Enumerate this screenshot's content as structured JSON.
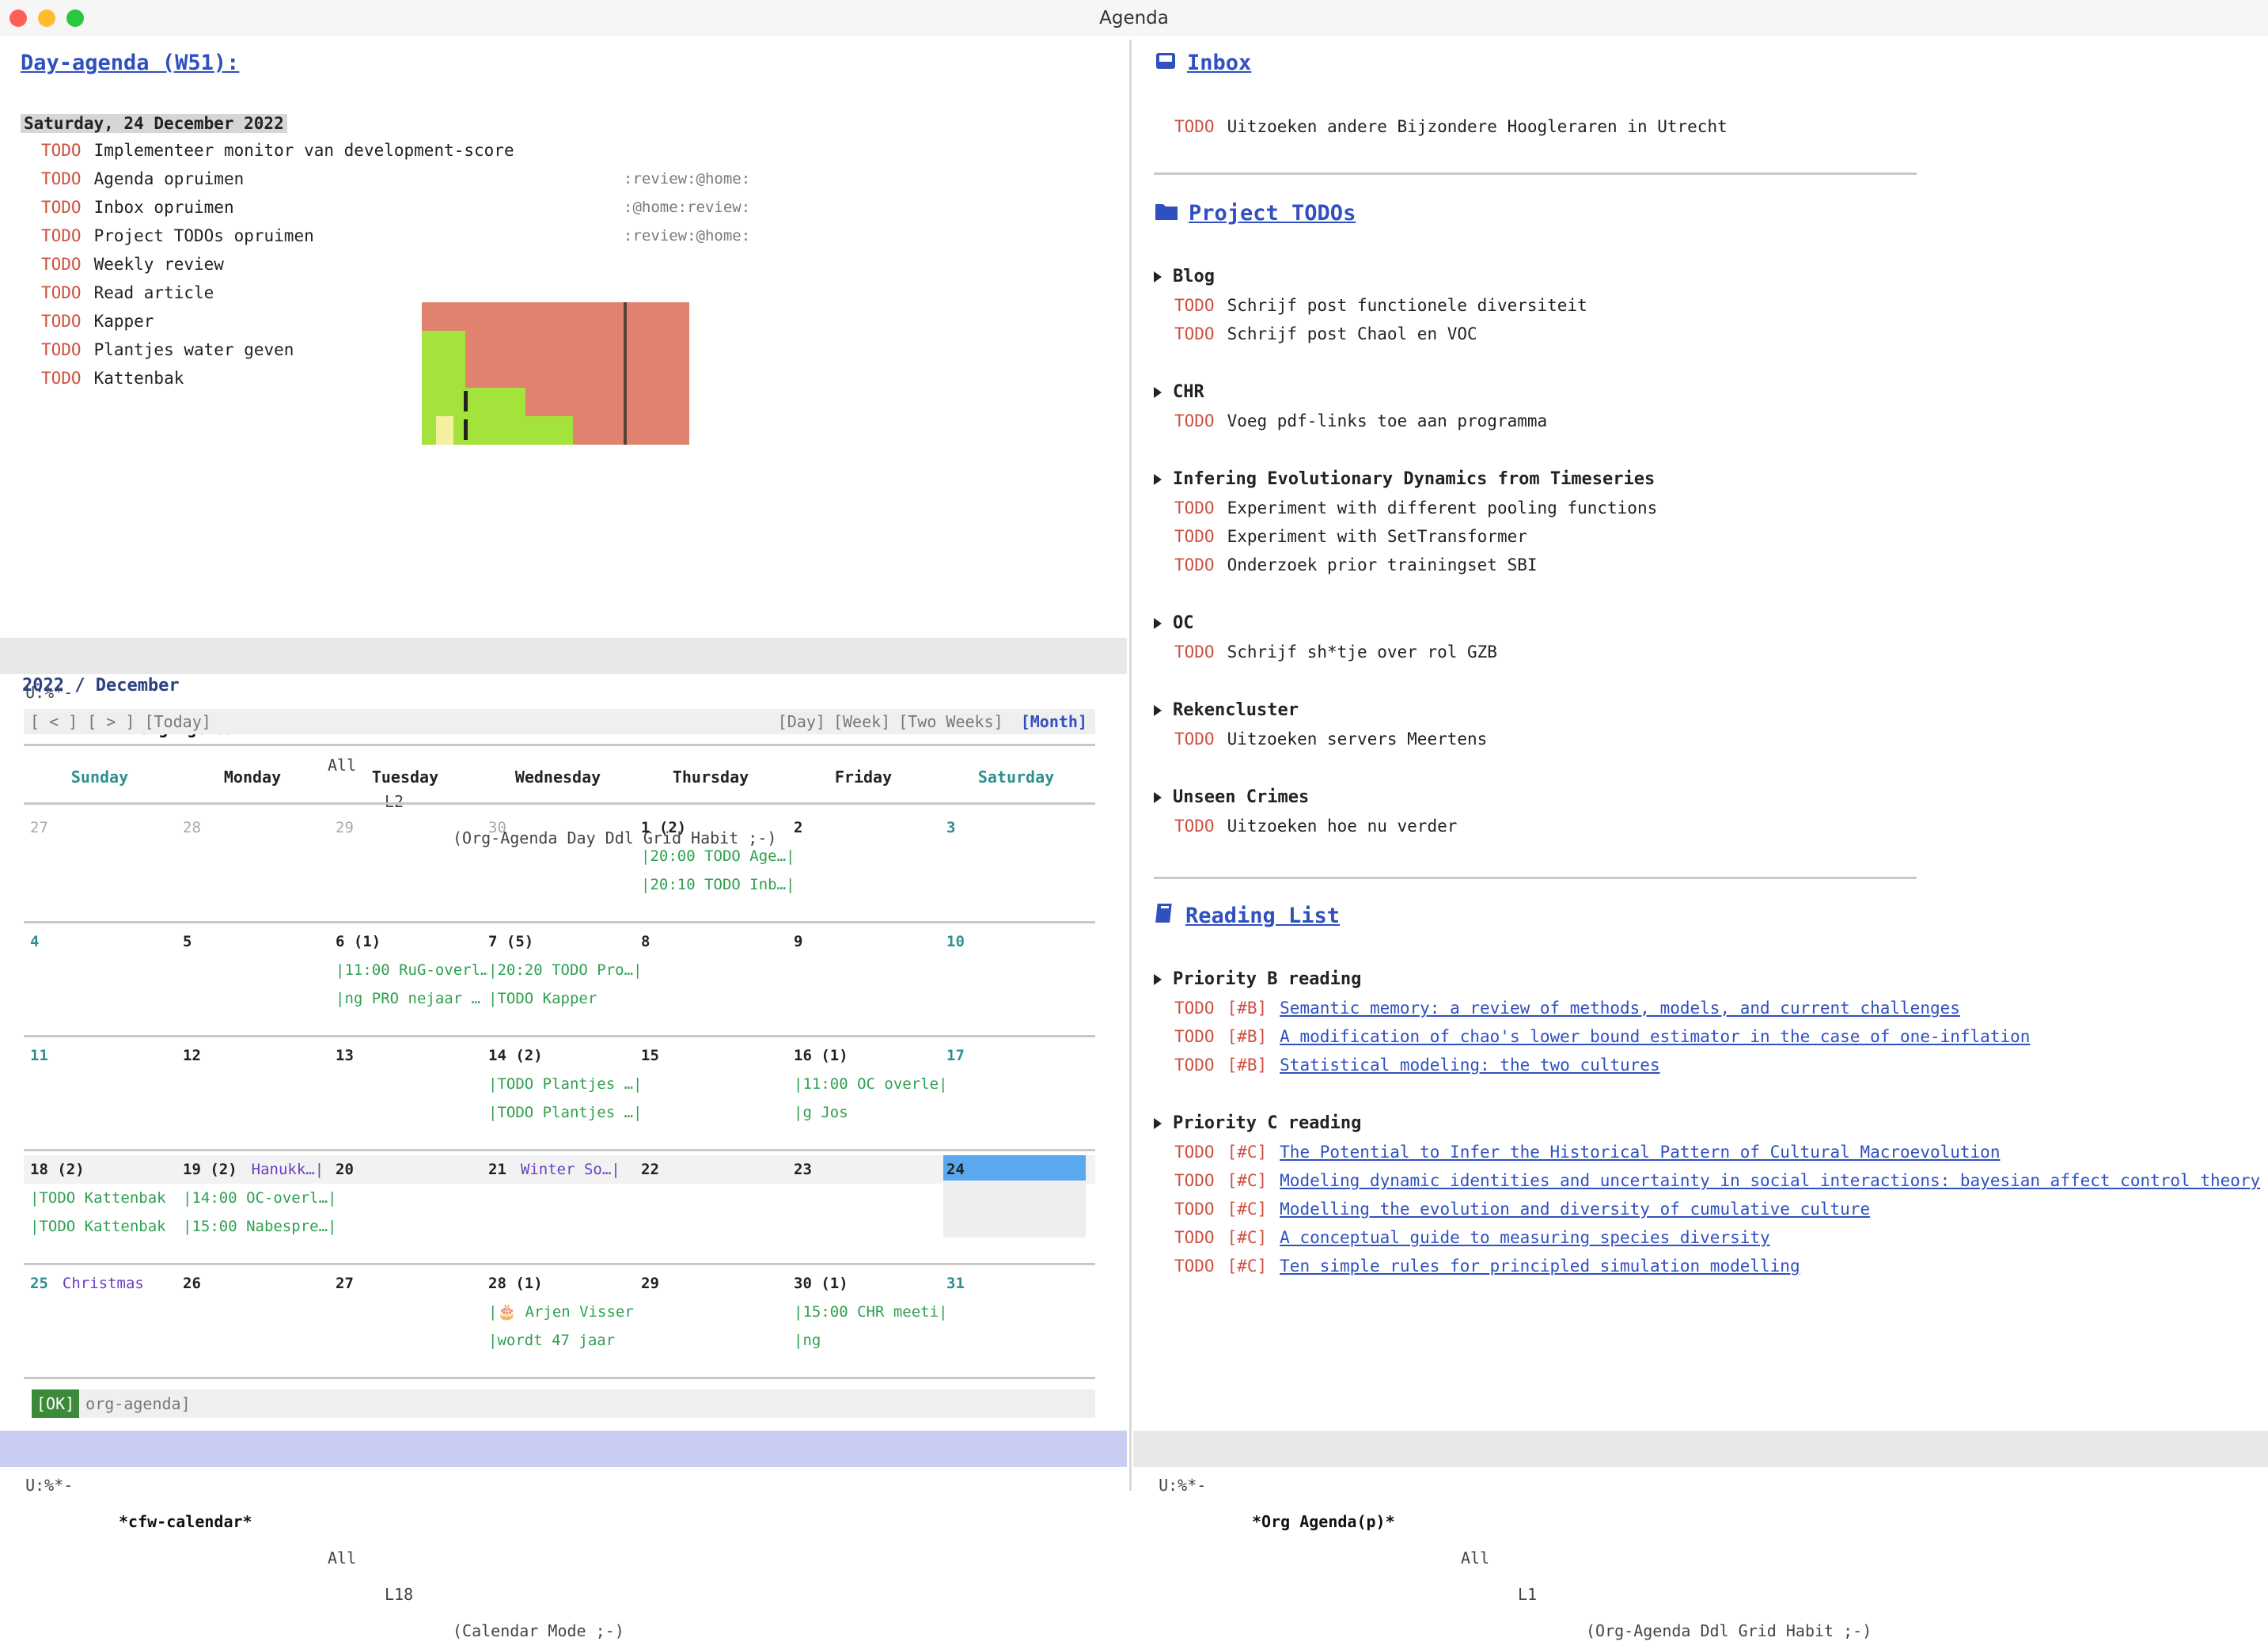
{
  "window": {
    "title": "Agenda"
  },
  "agenda": {
    "heading": "Day-agenda (W51):",
    "date": "Saturday, 24 December 2022",
    "items": [
      {
        "kw": "TODO",
        "text": "Implementeer monitor van development-score",
        "tags": ""
      },
      {
        "kw": "TODO",
        "text": "Agenda opruimen",
        "tags": ":review:@home:"
      },
      {
        "kw": "TODO",
        "text": "Inbox opruimen",
        "tags": ":@home:review:"
      },
      {
        "kw": "TODO",
        "text": "Project TODOs opruimen",
        "tags": ":review:@home:"
      },
      {
        "kw": "TODO",
        "text": "Weekly review",
        "tags": ""
      },
      {
        "kw": "TODO",
        "text": "Read article",
        "tags": ""
      },
      {
        "kw": "TODO",
        "text": "Kapper",
        "tags": ""
      },
      {
        "kw": "TODO",
        "text": "Plantjes water geven",
        "tags": ""
      },
      {
        "kw": "TODO",
        "text": "Kattenbak",
        "tags": ""
      }
    ],
    "habit_colors": {
      "overdue": "#e0826e",
      "done": "#a4e33c",
      "future": "#f4f0a0"
    }
  },
  "modeline_agenda": {
    "state": "U:%*-",
    "buffer": "*Org Agenda*",
    "pos": "All",
    "line": "L2",
    "modes": "(Org-Agenda Day Ddl Grid Habit ;-)"
  },
  "calendar": {
    "title": "2022 / December",
    "nav_left": "[ < ] [ > ] [Today]",
    "views": [
      "[Day]",
      "[Week]",
      "[Two Weeks]"
    ],
    "view_active": "[Month]",
    "days": [
      "Sunday",
      "Monday",
      "Tuesday",
      "Wednesday",
      "Thursday",
      "Friday",
      "Saturday"
    ],
    "weeks": [
      [
        {
          "d": "27",
          "other": true,
          "ev": []
        },
        {
          "d": "28",
          "other": true,
          "ev": []
        },
        {
          "d": "29",
          "other": true,
          "ev": []
        },
        {
          "d": "30",
          "other": true,
          "ev": []
        },
        {
          "d": "1 (2)",
          "ev": [
            "|20:00 TODO Age…|",
            "|20:10 TODO Inb…|"
          ]
        },
        {
          "d": "2",
          "ev": []
        },
        {
          "d": "3",
          "we": true,
          "ev": []
        }
      ],
      [
        {
          "d": "4",
          "we": true,
          "ev": []
        },
        {
          "d": "5",
          "ev": []
        },
        {
          "d": "6 (1)",
          "ev": [
            "|11:00 RuG-overl…",
            "|ng PRO nejaar …"
          ]
        },
        {
          "d": "7 (5)",
          "ev": [
            "|20:20 TODO Pro…|",
            "|TODO Kapper"
          ]
        },
        {
          "d": "8",
          "ev": []
        },
        {
          "d": "9",
          "ev": []
        },
        {
          "d": "10",
          "we": true,
          "ev": []
        }
      ],
      [
        {
          "d": "11",
          "we": true,
          "ev": []
        },
        {
          "d": "12",
          "ev": []
        },
        {
          "d": "13",
          "ev": []
        },
        {
          "d": "14 (2)",
          "ev": [
            "|TODO Plantjes …|",
            "|TODO Plantjes …|"
          ]
        },
        {
          "d": "15",
          "ev": []
        },
        {
          "d": "16 (1)",
          "ev": [
            "|11:00 OC overle|",
            "|g Jos"
          ]
        },
        {
          "d": "17",
          "we": true,
          "ev": []
        }
      ],
      [
        {
          "d": "18 (2)",
          "ev": [
            "|TODO Kattenbak",
            "|TODO Kattenbak"
          ]
        },
        {
          "d": "19 (2)",
          "hol": "Hanukk…|",
          "ev": [
            "|14:00 OC-overl…|",
            "|15:00 Nabespre…|"
          ]
        },
        {
          "d": "20",
          "ev": []
        },
        {
          "d": "21",
          "hol": "Winter So…|",
          "ev": []
        },
        {
          "d": "22",
          "ev": []
        },
        {
          "d": "23",
          "ev": []
        },
        {
          "d": "24",
          "today": true,
          "ev": []
        }
      ],
      [
        {
          "d": "25",
          "we": true,
          "hol": "Christmas",
          "ev": []
        },
        {
          "d": "26",
          "ev": []
        },
        {
          "d": "27",
          "ev": []
        },
        {
          "d": "28 (1)",
          "ev": [
            "|🎂 Arjen Visser |",
            "|wordt 47 jaar"
          ]
        },
        {
          "d": "29",
          "ev": []
        },
        {
          "d": "30 (1)",
          "ev": [
            "|15:00 CHR meeti|",
            "|ng"
          ]
        },
        {
          "d": "31",
          "we": true,
          "ev": []
        }
      ]
    ],
    "minibuffer_tag": "[OK]",
    "minibuffer_text": "org-agenda]"
  },
  "modeline_calendar": {
    "state": "U:%*-",
    "buffer": "*cfw-calendar*",
    "pos": "All",
    "line": "L18",
    "modes": "(Calendar Mode ;-)"
  },
  "right": {
    "inbox": {
      "title": "Inbox",
      "items": [
        {
          "kw": "TODO",
          "text": "Uitzoeken andere Bijzondere Hoogleraren in Utrecht"
        }
      ]
    },
    "projects": {
      "title": "Project TODOs",
      "groups": [
        {
          "name": "Blog",
          "items": [
            "Schrijf post functionele diversiteit",
            "Schrijf post Chaol en VOC"
          ]
        },
        {
          "name": "CHR",
          "items": [
            "Voeg pdf-links toe aan programma"
          ]
        },
        {
          "name": "Infering Evolutionary Dynamics from Timeseries",
          "items": [
            "Experiment with different pooling functions",
            "Experiment with SetTransformer",
            "Onderzoek prior trainingset SBI"
          ]
        },
        {
          "name": "OC",
          "items": [
            "Schrijf sh*tje over rol GZB"
          ]
        },
        {
          "name": "Rekencluster",
          "items": [
            "Uitzoeken servers Meertens"
          ]
        },
        {
          "name": "Unseen Crimes",
          "items": [
            "Uitzoeken hoe nu verder"
          ]
        }
      ]
    },
    "reading": {
      "title": "Reading List",
      "groups": [
        {
          "name": "Priority B reading",
          "pri": "[#B]",
          "items": [
            "Semantic memory: a review of methods, models, and current challenges",
            "A modification of chao's lower bound estimator in the case of one-inflation",
            "Statistical modeling: the two cultures"
          ]
        },
        {
          "name": "Priority C reading",
          "pri": "[#C]",
          "items": [
            "The Potential to Infer the Historical Pattern of Cultural Macroevolution",
            "Modeling dynamic identities and uncertainty in social interactions: bayesian affect control theory",
            "Modelling the evolution and diversity of cumulative culture",
            "A conceptual guide to measuring species diversity",
            "Ten simple rules for principled simulation modelling"
          ]
        }
      ]
    },
    "todo_kw": "TODO"
  },
  "modeline_right": {
    "state": "U:%*-",
    "buffer": "*Org Agenda(p)*",
    "pos": "All",
    "line": "L1",
    "modes": "(Org-Agenda Ddl Grid Habit ;-)"
  },
  "colors": {
    "todo": "#d05040",
    "link": "#3050c0",
    "event": "#2fa050",
    "weekend": "#2f8f8f",
    "today": "#5aa8ee"
  }
}
